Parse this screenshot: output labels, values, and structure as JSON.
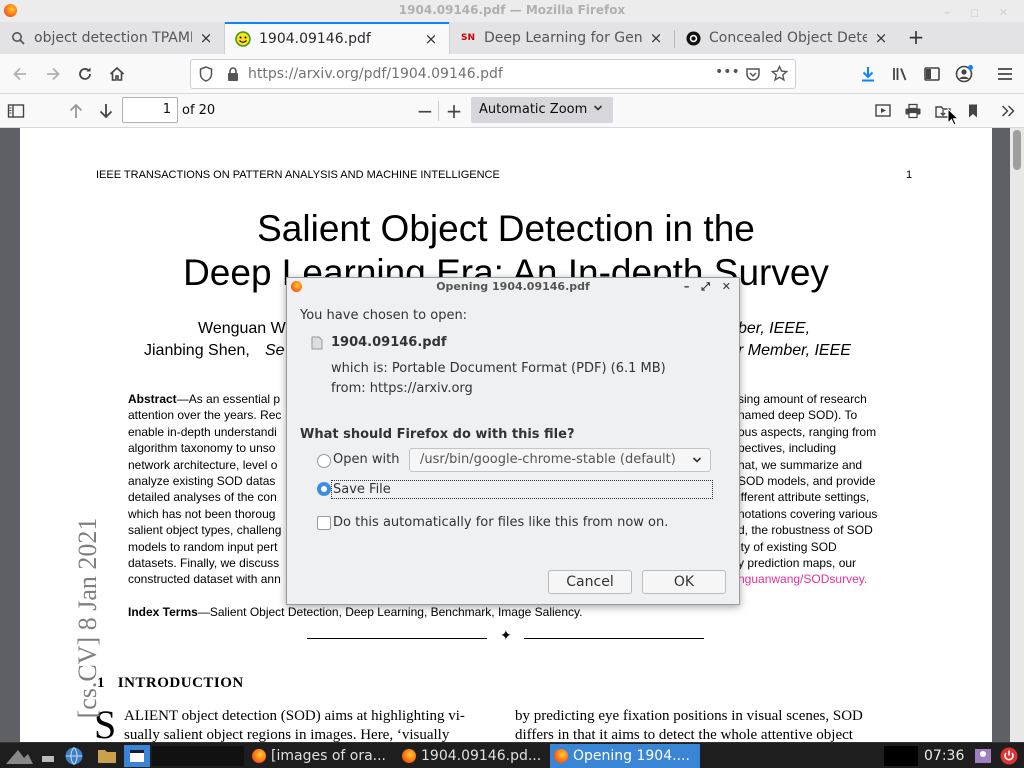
{
  "window": {
    "title": "1904.09146.pdf — Mozilla Firefox"
  },
  "tabs": [
    {
      "label": "object detection TPAMI ja",
      "favicon": "firefox-icon",
      "close": "×"
    },
    {
      "label": "1904.09146.pdf",
      "favicon": "smiley-pdf-icon",
      "close": "×"
    },
    {
      "label": "Deep Learning for Gener",
      "favicon": "SN",
      "close": "×"
    },
    {
      "label": "Concealed Object Detect",
      "favicon": "github-icon",
      "close": "×"
    }
  ],
  "newtab_label": "+",
  "urlbar": {
    "url": "https://arxiv.org/pdf/1904.09146.pdf",
    "more": "•••"
  },
  "pdf_toolbar": {
    "page_value": "1",
    "page_count": "of 20",
    "zoom_label": "Automatic Zoom",
    "zoom_out": "−",
    "zoom_in": "+"
  },
  "document": {
    "journal": "IEEE TRANSACTIONS ON PATTERN ANALYSIS AND MACHINE INTELLIGENCE",
    "page_number": "1",
    "title_line1": "Salient Object Detection in the",
    "title_line2": "Deep Learning Era: An In-depth Survey",
    "author1_start": "Wenguan W",
    "author1_end": "ber, IEEE,",
    "author2_start": "Jianbing Shen,",
    "author2_italic": "Se",
    "author2_end": "r Member, IEEE",
    "abstract_left": [
      {
        "bold": "Abstract",
        "text": "—As an essential p"
      },
      {
        "bold": "",
        "text": "attention over the years. Rec"
      },
      {
        "bold": "",
        "text": "enable in-depth understandi"
      },
      {
        "bold": "",
        "text": "algorithm taxonomy to unso"
      },
      {
        "bold": "",
        "text": "network architecture, level o"
      },
      {
        "bold": "",
        "text": "analyze existing SOD datas"
      },
      {
        "bold": "",
        "text": "detailed analyses of the con"
      },
      {
        "bold": "",
        "text": "which has not been thoroug"
      },
      {
        "bold": "",
        "text": "salient object types, challeng"
      },
      {
        "bold": "",
        "text": "models to random input pert"
      },
      {
        "bold": "",
        "text": "datasets. Finally, we discuss"
      },
      {
        "bold": "",
        "text": "constructed dataset with ann"
      }
    ],
    "abstract_right": [
      "sing amount of research",
      "named deep SOD). To",
      "ous aspects, ranging from",
      "pectives, including",
      "hat, we summarize and",
      "SOD models, and provide",
      "ifferent attribute settings,",
      "notations covering various",
      "d, the robustness of SOD",
      "lty of existing SOD",
      "y prediction maps, our",
      "nguanwang/SODsurvey."
    ],
    "link_color": "#e0309a",
    "index_terms_label": "Index Terms",
    "index_terms": "—Salient Object Detection, Deep Learning, Benchmark, Image Saliency.",
    "diamond": "✦",
    "section_num": "1",
    "section_title": "INTRODUCTION",
    "dropcap": "S",
    "body_left_1": "ALIENT object detection (SOD) aims at highlighting vi-",
    "body_left_2": "sually salient object regions in images. Here, ‘visually",
    "body_right_1": "by predicting eye fixation positions in visual scenes, SOD",
    "body_right_2": "differs in that it aims to detect the whole attentive object",
    "arxiv_stamp": "[cs.CV]  8 Jan 2021"
  },
  "dialog": {
    "title": "Opening 1904.09146.pdf",
    "chosen_label": "You have chosen to open:",
    "filename": "1904.09146.pdf",
    "which_is": "which is: Portable Document Format (PDF) (6.1 MB)",
    "from": "from: https://arxiv.org",
    "question": "What should Firefox do with this file?",
    "open_with_label": "Open with",
    "open_with_app": "/usr/bin/google-chrome-stable (default)",
    "save_file_label": "Save File",
    "auto_label": "Do this automatically for files like this from now on.",
    "cancel": "Cancel",
    "ok": "OK",
    "selected_option": "save"
  },
  "taskbar": {
    "tasks": [
      "[images of ora...",
      "1904.09146.pd...",
      "Opening 1904...."
    ],
    "clock": "07:36"
  }
}
